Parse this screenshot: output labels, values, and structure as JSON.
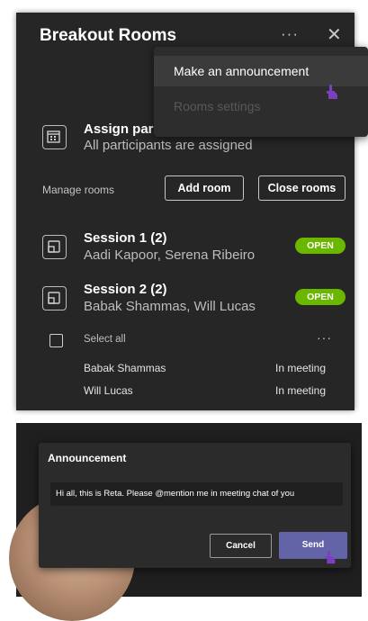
{
  "panel": {
    "title": "Breakout Rooms",
    "more_icon": "more-options-icon",
    "close_icon": "close-icon"
  },
  "menu": {
    "items": [
      {
        "label": "Make an announcement",
        "highlighted": true
      },
      {
        "label": "Rooms settings",
        "disabled": true
      }
    ]
  },
  "assign": {
    "title": "Assign par",
    "subtitle": "All participants are assigned"
  },
  "manage": {
    "label": "Manage rooms",
    "add_room": "Add room",
    "close_rooms": "Close rooms"
  },
  "rooms": [
    {
      "name": "Session 1 (2)",
      "members": "Aadi Kapoor, Serena Ribeiro",
      "status": "OPEN"
    },
    {
      "name": "Session 2 (2)",
      "members": "Babak Shammas, Will Lucas",
      "status": "OPEN"
    }
  ],
  "participants": {
    "select_all": "Select all",
    "items": [
      {
        "name": "Babak Shammas",
        "status": "In meeting"
      },
      {
        "name": "Will Lucas",
        "status": "In meeting"
      }
    ]
  },
  "announcement": {
    "title": "Announcement",
    "message": "Hi all, this is Reta. Please @mention me in meeting chat of you",
    "cancel": "Cancel",
    "send": "Send"
  },
  "colors": {
    "open_badge": "#6bb700",
    "send_button": "#6264a7",
    "cursor": "#7b3fbf"
  }
}
